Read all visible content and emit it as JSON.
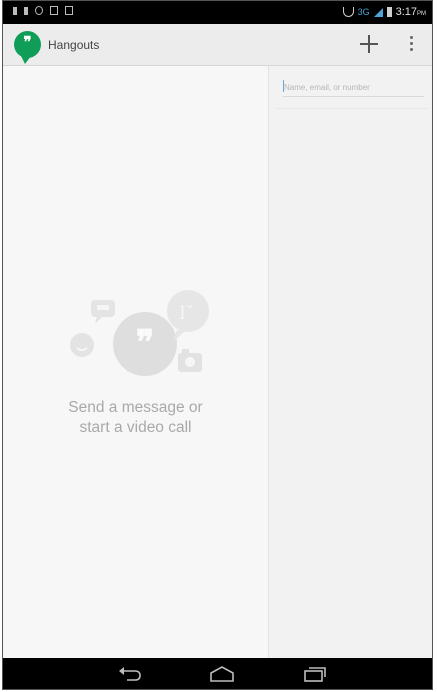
{
  "app": {
    "title": "Hangouts"
  },
  "status_bar": {
    "network": "3G",
    "time": "3:17",
    "ampm": "PM"
  },
  "search": {
    "placeholder": "Name, email, or number"
  },
  "empty_state": {
    "line1": "Send a message or",
    "line2": "start a video call"
  },
  "colors": {
    "brand": "#0f9d58",
    "actionbar": "#ececec",
    "accent": "#4fa3d8"
  },
  "icons": [
    "hangouts-logo-icon",
    "add-icon",
    "overflow-menu-icon",
    "back-icon",
    "home-icon",
    "recent-apps-icon"
  ]
}
